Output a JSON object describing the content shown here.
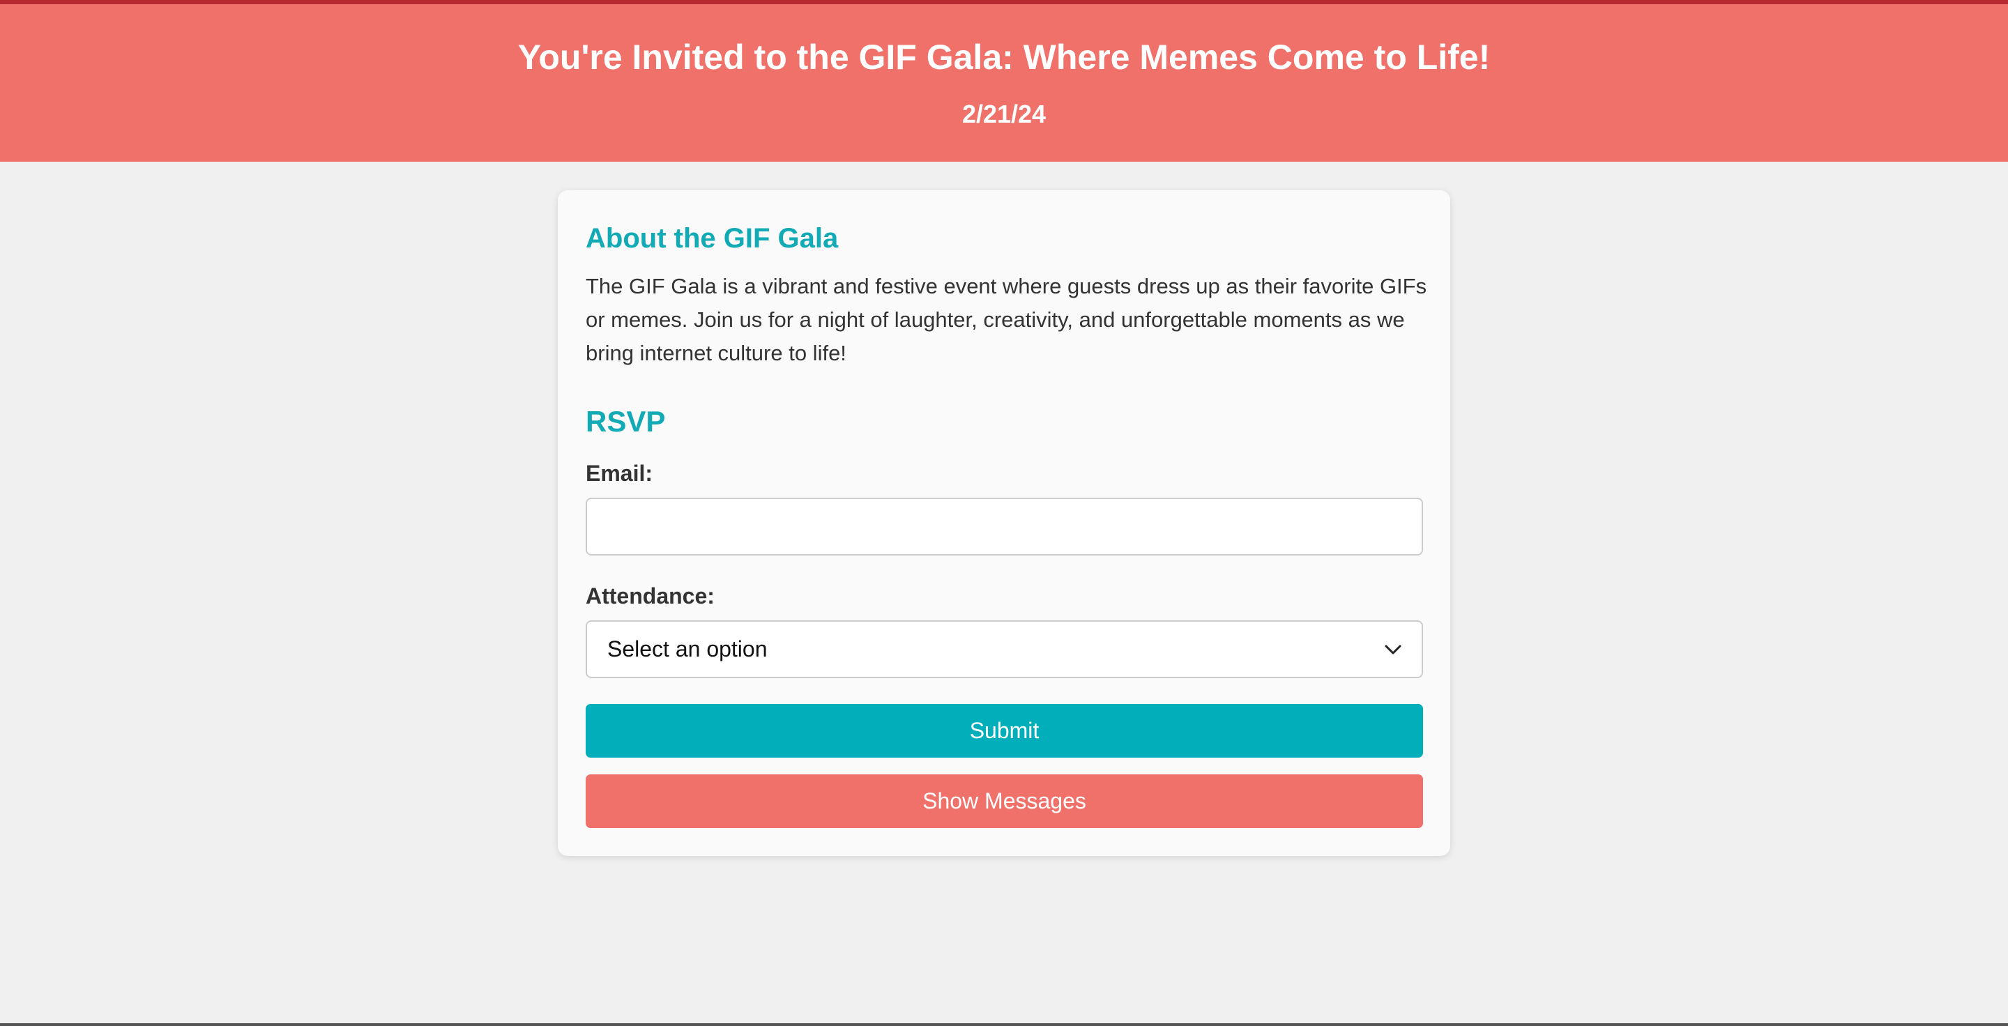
{
  "header": {
    "title": "You're Invited to the GIF Gala: Where Memes Come to Life!",
    "date": "2/21/24"
  },
  "about": {
    "title": "About the GIF Gala",
    "text": "The GIF Gala is a vibrant and festive event where guests dress up as their favorite GIFs or memes. Join us for a night of laughter, creativity, and unforgettable moments as we bring internet culture to life!"
  },
  "rsvp": {
    "title": "RSVP",
    "email_label": "Email:",
    "email_value": "",
    "attendance_label": "Attendance:",
    "attendance_selected": "Select an option",
    "submit_label": "Submit",
    "show_messages_label": "Show Messages"
  },
  "colors": {
    "header_bg": "#f0716a",
    "accent_teal": "#03aebb",
    "heading_teal": "#11aab5",
    "page_bg": "#f0f0f0",
    "card_bg": "#fafafa"
  },
  "icons": {
    "select_arrow": "chevron-down-icon"
  }
}
